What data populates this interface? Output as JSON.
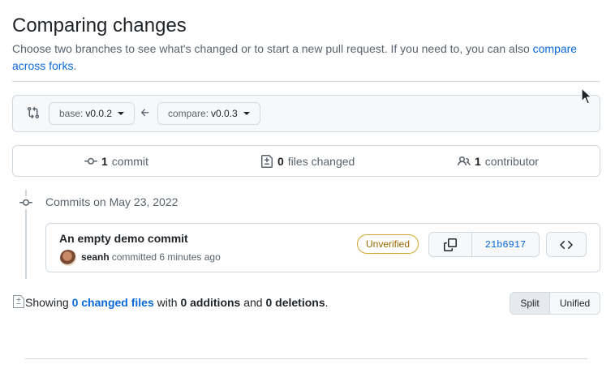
{
  "header": {
    "title": "Comparing changes",
    "description": "Choose two branches to see what's changed or to start a new pull request. If you need to, you can also ",
    "link": "compare across forks",
    "link_suffix": "."
  },
  "range": {
    "base_label": "base:",
    "base_value": "v0.0.2",
    "compare_label": "compare:",
    "compare_value": "v0.0.3"
  },
  "stats": {
    "commits_count": "1",
    "commits_label": "commit",
    "files_count": "0",
    "files_label": "files changed",
    "contributors_count": "1",
    "contributors_label": "contributor"
  },
  "commits": {
    "date_heading": "Commits on May 23, 2022",
    "items": [
      {
        "title": "An empty demo commit",
        "author": "seanh",
        "meta": "committed 6 minutes ago",
        "badge": "Unverified",
        "sha": "21b6917"
      }
    ]
  },
  "summary": {
    "prefix": "Showing ",
    "files_link": "0 changed files",
    "mid1": " with ",
    "additions": "0 additions",
    "mid2": " and ",
    "deletions": "0 deletions",
    "suffix": "."
  },
  "view_toggle": {
    "split": "Split",
    "unified": "Unified",
    "selected": "Split"
  },
  "colors": {
    "link": "#0969da",
    "muted": "#59636e",
    "border": "#d1d9e0",
    "badge_unverified": "#9a6700"
  },
  "icons": {
    "range": "git-compare-icon",
    "arrow": "arrow-left-icon",
    "commit": "git-commit-icon",
    "files": "file-diff-icon",
    "contributors": "people-icon",
    "copy": "copy-icon",
    "browse": "code-icon"
  }
}
